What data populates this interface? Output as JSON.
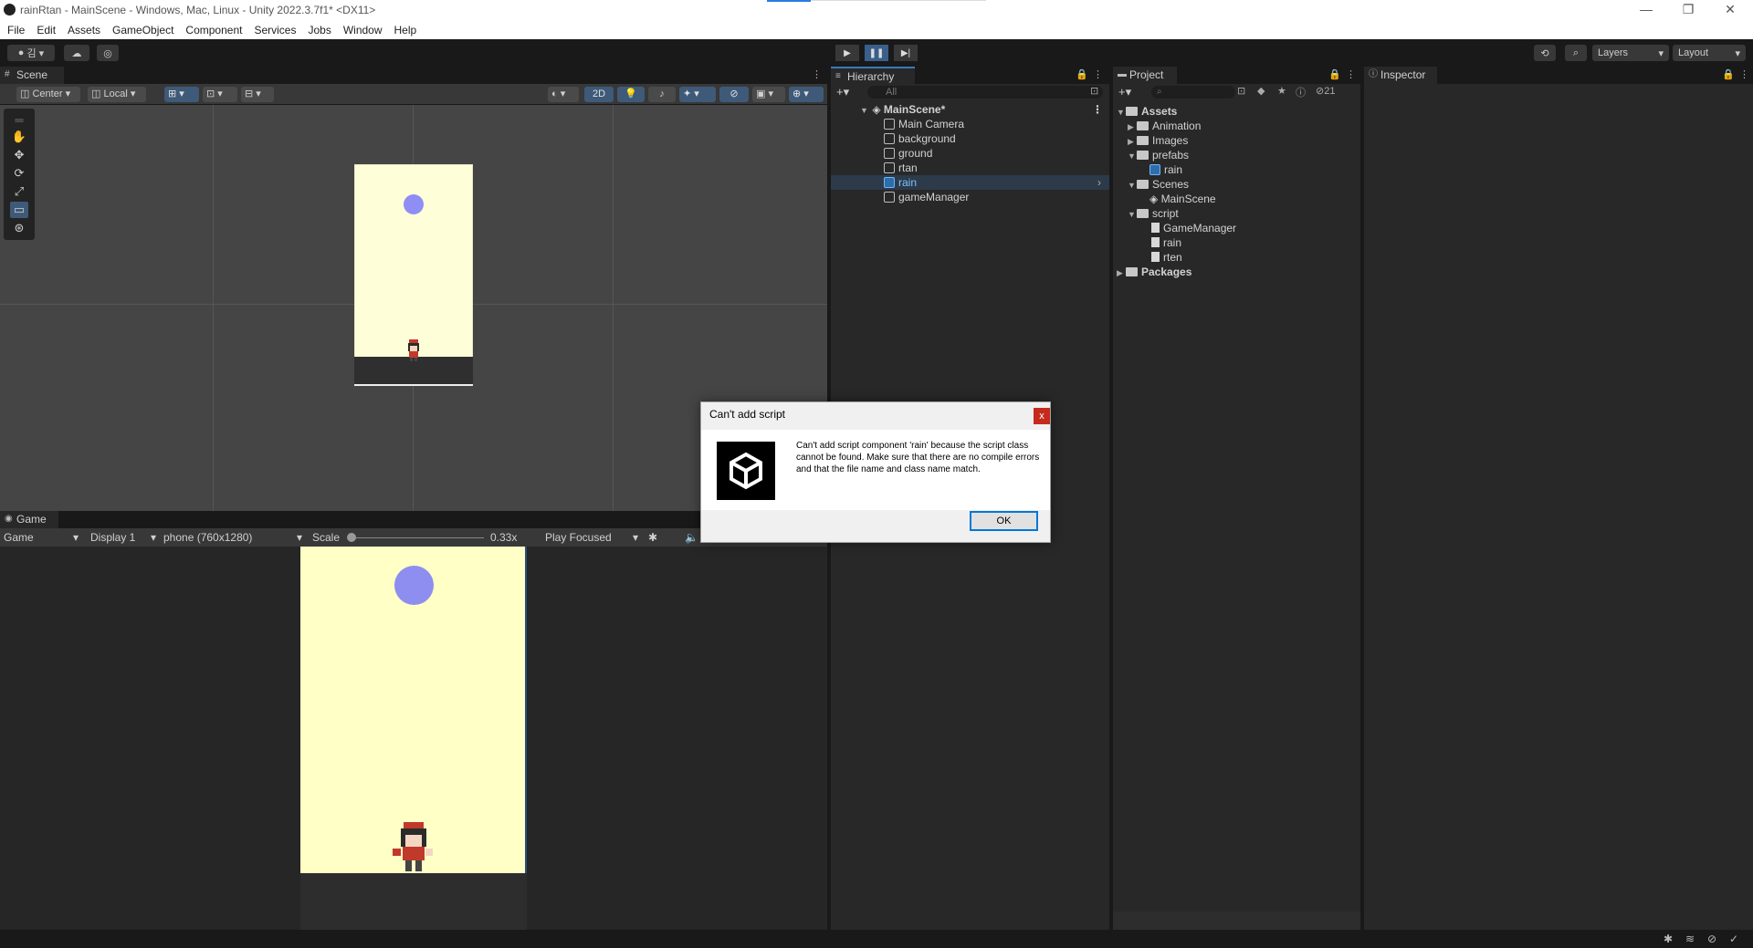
{
  "window": {
    "title": "rainRtan - MainScene - Windows, Mac, Linux - Unity 2022.3.7f1* <DX11>",
    "minimize": "—",
    "restore": "❐",
    "close": "✕"
  },
  "menu": [
    "File",
    "Edit",
    "Assets",
    "GameObject",
    "Component",
    "Services",
    "Jobs",
    "Window",
    "Help"
  ],
  "toolbar": {
    "account_label": "김",
    "layers": "Layers",
    "layout": "Layout"
  },
  "scene": {
    "tab": "Scene",
    "pivot": "Center",
    "space": "Local",
    "mode_2d": "2D"
  },
  "game": {
    "tab": "Game",
    "view": "Game",
    "display": "Display 1",
    "resolution": "phone (760x1280)",
    "scale_label": "Scale",
    "scale_value": "0.33x",
    "play_mode": "Play Focused"
  },
  "hierarchy": {
    "tab": "Hierarchy",
    "search_placeholder": "All",
    "scene_name": "MainScene*",
    "items": [
      "Main Camera",
      "background",
      "ground",
      "rtan",
      "rain",
      "gameManager"
    ],
    "selected": "rain"
  },
  "project": {
    "tab": "Project",
    "hidden_count": "21",
    "tree": {
      "assets": "Assets",
      "animation": "Animation",
      "images": "Images",
      "prefabs": "prefabs",
      "prefab_rain": "rain",
      "scenes": "Scenes",
      "main_scene": "MainScene",
      "script": "script",
      "game_manager": "GameManager",
      "script_rain": "rain",
      "script_rten": "rten",
      "packages": "Packages"
    }
  },
  "inspector": {
    "tab": "Inspector"
  },
  "dialog": {
    "title": "Can't add script",
    "close": "x",
    "message": "Can't add script component 'rain' because the script class cannot be found. Make sure that there are no compile errors and that the file name and class name match.",
    "ok": "OK"
  },
  "colors": {
    "accent": "#3a79bb",
    "camera_bg": "#ffffc6",
    "ball": "#8d8ef0",
    "close_red": "#c42b1c"
  }
}
